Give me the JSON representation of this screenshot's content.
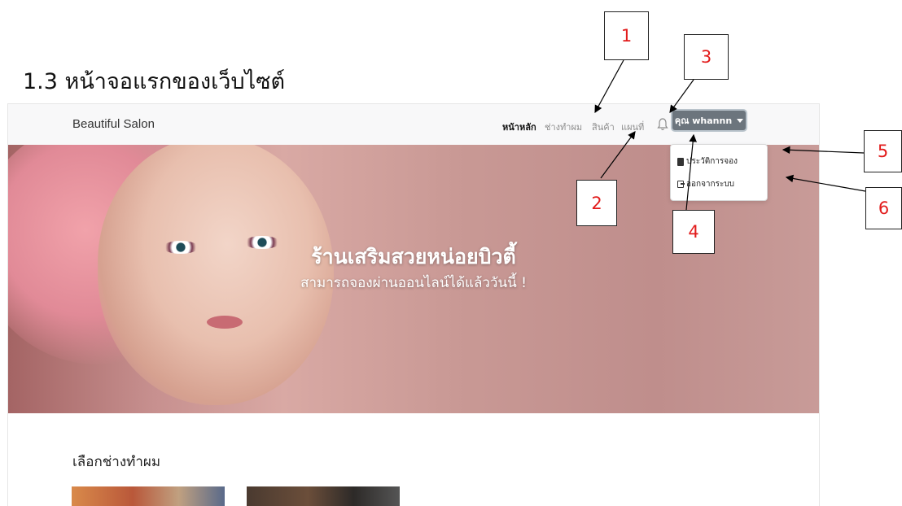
{
  "document": {
    "heading": "1.3 หน้าจอแรกของเว็บไซต์"
  },
  "navbar": {
    "brand": "Beautiful Salon",
    "links": [
      "หน้าหลัก",
      "ช่างทำผม",
      "สินค้า",
      "แผนที่"
    ],
    "user_button": "คุณ whannn"
  },
  "hero": {
    "title": "ร้านเสริมสวยหน่อยบิวตี้",
    "subtitle": "สามารถจองผ่านออนไลน์ได้แล้ววันนี้ !"
  },
  "dropdown": {
    "items": [
      {
        "icon": "book-icon",
        "label": "ประวัติการจอง"
      },
      {
        "icon": "logout-icon",
        "label": "ออกจากระบบ"
      }
    ]
  },
  "section": {
    "title": "เลือกช่างทำผม"
  },
  "callouts": [
    "1",
    "2",
    "3",
    "4",
    "5",
    "6"
  ],
  "colors": {
    "user_button_bg": "#6c757d",
    "callout_text": "#e21b1b",
    "navbar_bg": "#f8f8f9"
  }
}
